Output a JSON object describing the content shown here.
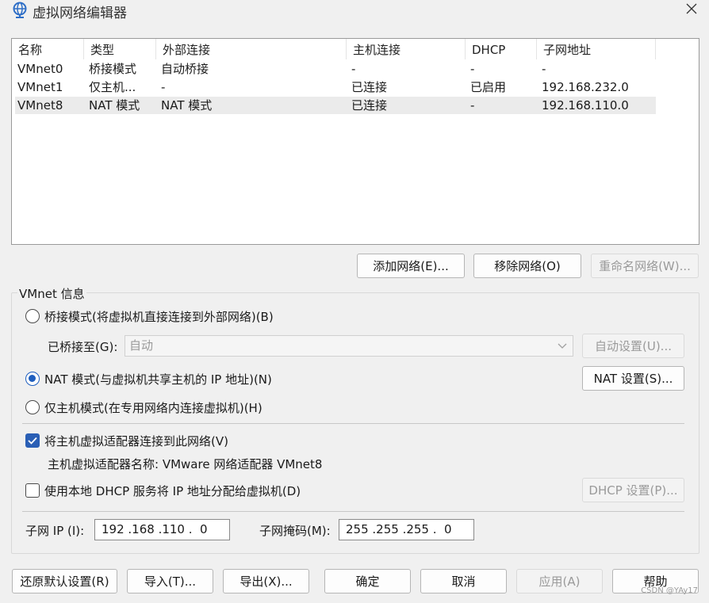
{
  "window": {
    "title": "虚拟网络编辑器"
  },
  "network_list": {
    "columns": [
      "名称",
      "类型",
      "外部连接",
      "主机连接",
      "DHCP",
      "子网地址"
    ],
    "rows": [
      {
        "name": "VMnet0",
        "type": "桥接模式",
        "external": "自动桥接",
        "host": "-",
        "dhcp": "-",
        "subnet": "-"
      },
      {
        "name": "VMnet1",
        "type": "仅主机...",
        "external": "-",
        "host": "已连接",
        "dhcp": "已启用",
        "subnet": "192.168.232.0"
      },
      {
        "name": "VMnet8",
        "type": "NAT 模式",
        "external": "NAT 模式",
        "host": "已连接",
        "dhcp": "-",
        "subnet": "192.168.110.0"
      }
    ],
    "selected_row": 2
  },
  "list_buttons": {
    "add": "添加网络(E)...",
    "remove": "移除网络(O)",
    "rename": "重命名网络(W)..."
  },
  "vmnet_info": {
    "group_title": "VMnet 信息",
    "bridge_option": "桥接模式(将虚拟机直接连接到外部网络)(B)",
    "bridged_to_label": "已桥接至(G):",
    "bridged_to_value": "自动",
    "auto_settings": "自动设置(U)...",
    "nat_option": "NAT 模式(与虚拟机共享主机的 IP 地址)(N)",
    "nat_settings": "NAT 设置(S)...",
    "hostonly_option": "仅主机模式(在专用网络内连接虚拟机)(H)",
    "connect_adapter": "将主机虚拟适配器连接到此网络(V)",
    "adapter_name": "主机虚拟适配器名称: VMware 网络适配器 VMnet8",
    "dhcp_option": "使用本地 DHCP 服务将 IP 地址分配给虚拟机(D)",
    "dhcp_settings": "DHCP 设置(P)...",
    "subnet_ip_label": "子网 IP (I):",
    "subnet_ip": "192 .168 .110 .  0",
    "subnet_mask_label": "子网掩码(M):",
    "subnet_mask": "255 .255 .255 .  0"
  },
  "bottom_buttons": {
    "restore": "还原默认设置(R)",
    "import": "导入(T)...",
    "export": "导出(X)...",
    "ok": "确定",
    "cancel": "取消",
    "apply": "应用(A)",
    "help": "帮助"
  },
  "watermark": "CSDN @YAy17",
  "colors": {
    "accent": "#1f5fbf",
    "background": "#f0f0f0",
    "disabled_text": "#9a9a9a",
    "selected_row": "#ebebeb"
  }
}
